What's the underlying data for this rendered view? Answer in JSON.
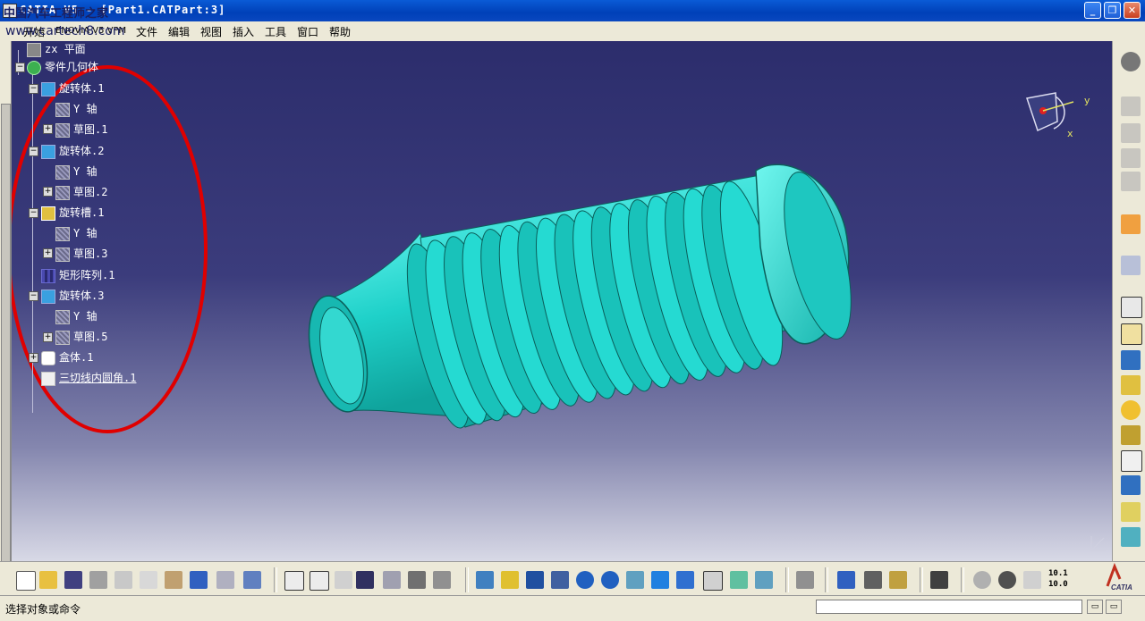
{
  "window": {
    "title": "CATIA V5 - [Part1.CATPart:3]",
    "minimize": "_",
    "restore": "❐",
    "close": "✕"
  },
  "watermark": {
    "line1": "中国汽车工程师之家",
    "line2": "www.cartech8.com"
  },
  "menu": {
    "items": [
      "开始",
      "ENOVIA V5 VPM",
      "文件",
      "编辑",
      "视图",
      "插入",
      "工具",
      "窗口",
      "帮助"
    ]
  },
  "tree": {
    "items": [
      {
        "label": "zx 平面",
        "icon": "plane-icon"
      },
      {
        "label": "零件几何体",
        "icon": "part-body-icon"
      },
      {
        "label": "旋转体.1",
        "icon": "shaft-icon"
      },
      {
        "label": "Y 轴",
        "icon": "axis-icon"
      },
      {
        "label": "草图.1",
        "icon": "sketch-icon"
      },
      {
        "label": "旋转体.2",
        "icon": "shaft-icon"
      },
      {
        "label": "Y 轴",
        "icon": "axis-icon"
      },
      {
        "label": "草图.2",
        "icon": "sketch-icon"
      },
      {
        "label": "旋转槽.1",
        "icon": "groove-icon"
      },
      {
        "label": "Y 轴",
        "icon": "axis-icon"
      },
      {
        "label": "草图.3",
        "icon": "sketch-icon"
      },
      {
        "label": "矩形阵列.1",
        "icon": "pattern-icon"
      },
      {
        "label": "旋转体.3",
        "icon": "shaft-icon"
      },
      {
        "label": "Y 轴",
        "icon": "axis-icon"
      },
      {
        "label": "草图.5",
        "icon": "sketch-icon"
      },
      {
        "label": "盒体.1",
        "icon": "shell-icon"
      },
      {
        "label": "三切线内圆角.1",
        "icon": "tritangent-fillet-icon"
      }
    ]
  },
  "compass": {
    "y_label": "y",
    "x_label": "x"
  },
  "status": {
    "prompt": "选择对象或命令",
    "command_value": ""
  },
  "toolbar": {
    "zoom_values": {
      "top": "10.1",
      "bottom": "10.0"
    }
  },
  "colors": {
    "part": "#1fd1c9",
    "annotation_circle": "#e00000",
    "title_bar": "#0a5bd6"
  }
}
